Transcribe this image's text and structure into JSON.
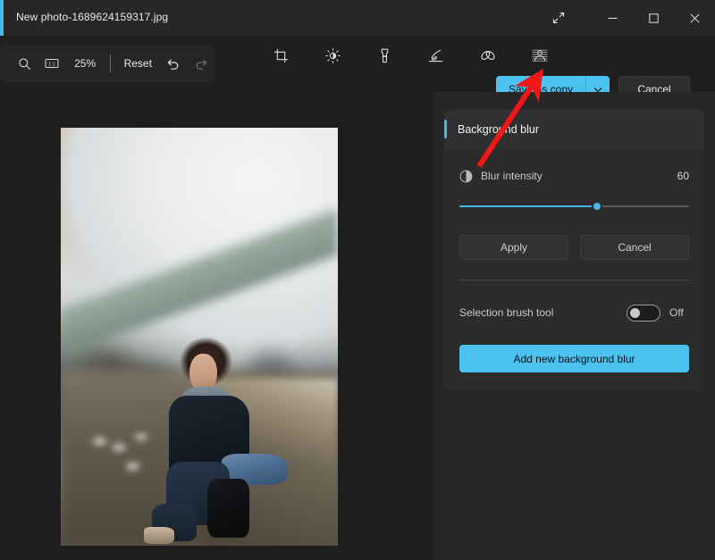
{
  "window": {
    "title": "New photo-1689624159317.jpg",
    "controls": {
      "expand": "expand-icon",
      "minimize": "minimize-icon",
      "maximize": "maximize-icon",
      "close": "close-icon"
    },
    "accent_color": "#4cb4e7"
  },
  "toolbar": {
    "zoom_out_icon": "zoom-out-icon",
    "fit_icon": "actual-size-icon",
    "zoom_level": "25%",
    "reset_label": "Reset",
    "undo_icon": "undo-icon",
    "redo_icon": "redo-icon",
    "tools": [
      {
        "name": "crop",
        "icon": "crop-icon",
        "selected": false
      },
      {
        "name": "adjustment",
        "icon": "brightness-icon",
        "selected": false
      },
      {
        "name": "markup",
        "icon": "marker-icon",
        "selected": false
      },
      {
        "name": "erase",
        "icon": "highlighter-icon",
        "selected": false
      },
      {
        "name": "retouch",
        "icon": "retouch-icon",
        "selected": false
      },
      {
        "name": "background-blur",
        "icon": "background-blur-icon",
        "selected": true
      }
    ],
    "save_label": "Save as copy",
    "save_caret_icon": "chevron-down-icon",
    "cancel_label": "Cancel",
    "save_button_color": "#4cc2f1"
  },
  "panel": {
    "section_title": "Background blur",
    "intensity": {
      "icon": "contrast-icon",
      "label": "Blur intensity",
      "value": "60",
      "percent": 60
    },
    "apply_label": "Apply",
    "cancel_label": "Cancel",
    "brush": {
      "label": "Selection brush tool",
      "state": "Off",
      "enabled": false
    },
    "add_label": "Add new background blur"
  },
  "annotation": {
    "arrow_color": "#f21717",
    "target": "Save as copy"
  }
}
